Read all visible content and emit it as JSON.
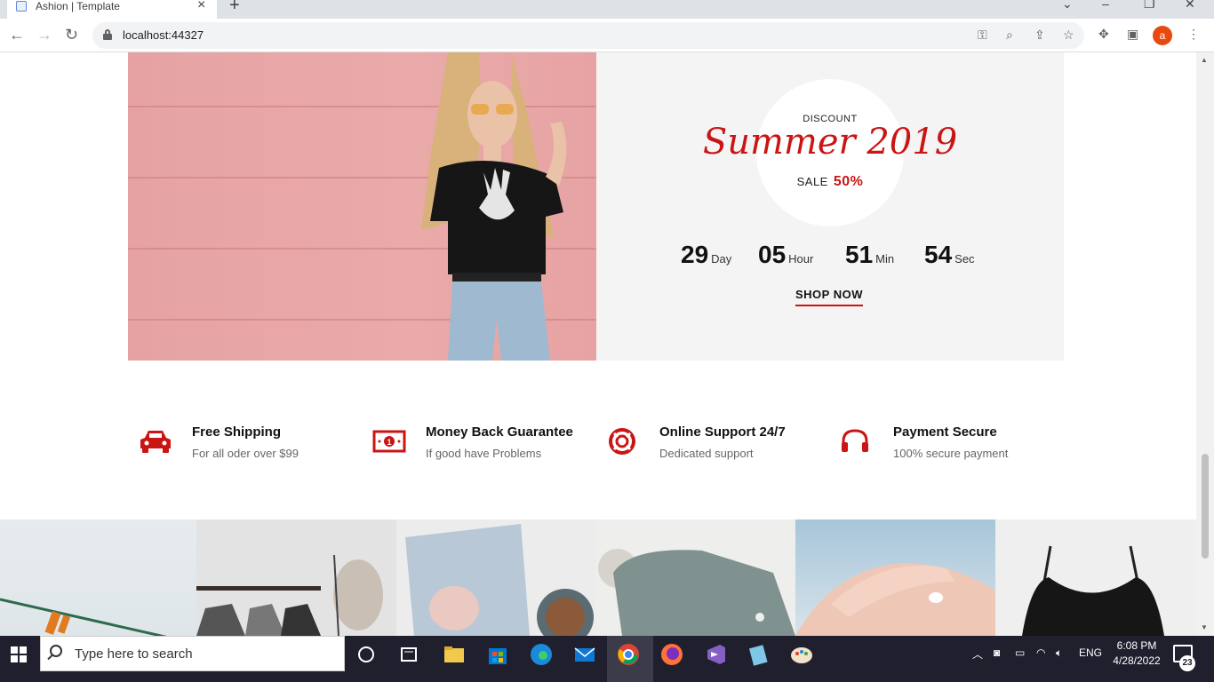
{
  "browser": {
    "tab_title": "Ashion | Template",
    "url": "localhost:44327",
    "profile_initial": "a"
  },
  "discount": {
    "label": "DISCOUNT",
    "title": "Summer 2019",
    "sale_label": "SALE",
    "sale_percent": "50%",
    "countdown": [
      {
        "value": "29",
        "unit": "Day"
      },
      {
        "value": "05",
        "unit": "Hour"
      },
      {
        "value": "51",
        "unit": "Min"
      },
      {
        "value": "54",
        "unit": "Sec"
      }
    ],
    "cta": "SHOP NOW"
  },
  "services": [
    {
      "icon": "car-icon",
      "title": "Free Shipping",
      "subtitle": "For all oder over $99"
    },
    {
      "icon": "money-icon",
      "title": "Money Back Guarantee",
      "subtitle": "If good have Problems"
    },
    {
      "icon": "life-ring-icon",
      "title": "Online Support 24/7",
      "subtitle": "Dedicated support"
    },
    {
      "icon": "headphones-icon",
      "title": "Payment Secure",
      "subtitle": "100% secure payment"
    }
  ],
  "colors": {
    "accent": "#ca1515",
    "panel": "#f4f4f4"
  },
  "taskbar": {
    "search_placeholder": "Type here to search",
    "language": "ENG",
    "time": "6:08 PM",
    "date": "4/28/2022",
    "notifications": "23"
  }
}
